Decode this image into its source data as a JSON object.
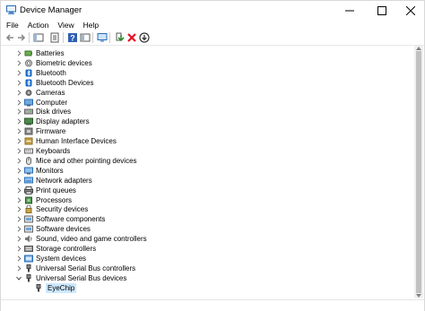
{
  "window": {
    "title": "Device Manager",
    "app_icon": "device-manager-icon"
  },
  "menu": [
    {
      "label": "File"
    },
    {
      "label": "Action"
    },
    {
      "label": "View"
    },
    {
      "label": "Help"
    }
  ],
  "toolbar": {
    "buttons": [
      "back-icon",
      "forward-icon",
      "show-hide-console-tree-icon",
      "properties-icon",
      "help-icon",
      "view-icon",
      "monitor-icon",
      "update-driver-icon",
      "uninstall-device-icon",
      "download-icon"
    ]
  },
  "tree": {
    "categories": [
      {
        "label": "Batteries",
        "icon": "battery-icon"
      },
      {
        "label": "Biometric devices",
        "icon": "biometric-icon"
      },
      {
        "label": "Bluetooth",
        "icon": "bluetooth-icon"
      },
      {
        "label": "Bluetooth Devices",
        "icon": "bluetooth-icon"
      },
      {
        "label": "Cameras",
        "icon": "camera-icon"
      },
      {
        "label": "Computer",
        "icon": "computer-icon"
      },
      {
        "label": "Disk drives",
        "icon": "disk-icon"
      },
      {
        "label": "Display adapters",
        "icon": "display-icon"
      },
      {
        "label": "Firmware",
        "icon": "firmware-icon"
      },
      {
        "label": "Human Interface Devices",
        "icon": "hid-icon"
      },
      {
        "label": "Keyboards",
        "icon": "keyboard-icon"
      },
      {
        "label": "Mice and other pointing devices",
        "icon": "mouse-icon"
      },
      {
        "label": "Monitors",
        "icon": "monitor-icon"
      },
      {
        "label": "Network adapters",
        "icon": "network-icon"
      },
      {
        "label": "Print queues",
        "icon": "printer-icon"
      },
      {
        "label": "Processors",
        "icon": "processor-icon"
      },
      {
        "label": "Security devices",
        "icon": "security-icon"
      },
      {
        "label": "Software components",
        "icon": "software-icon"
      },
      {
        "label": "Software devices",
        "icon": "software-icon"
      },
      {
        "label": "Sound, video and game controllers",
        "icon": "sound-icon"
      },
      {
        "label": "Storage controllers",
        "icon": "storage-icon"
      },
      {
        "label": "System devices",
        "icon": "system-icon"
      },
      {
        "label": "Universal Serial Bus controllers",
        "icon": "usb-icon"
      },
      {
        "label": "Universal Serial Bus devices",
        "icon": "usb-icon",
        "expanded": true
      }
    ],
    "child": {
      "label": "EyeChip",
      "icon": "usb-device-icon",
      "selected": true
    }
  },
  "colors": {
    "selection": "#cce8ff",
    "accent_blue": "#0078d7",
    "uninstall_red": "#e81123",
    "update_green": "#2e8b2e"
  }
}
